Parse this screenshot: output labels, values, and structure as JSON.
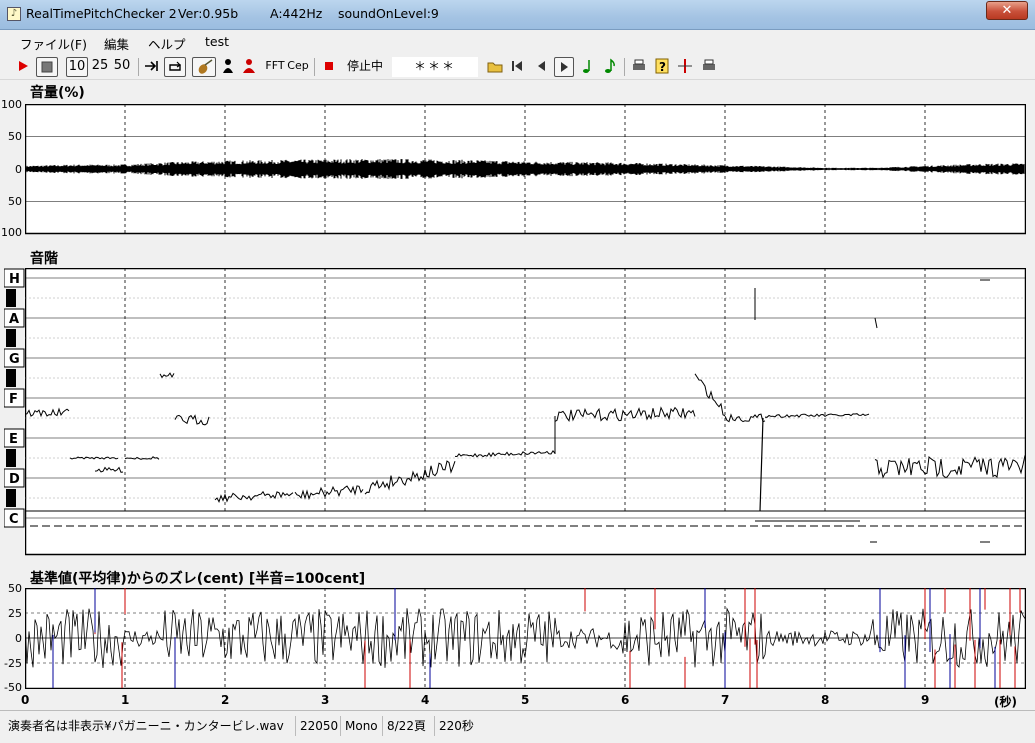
{
  "window": {
    "app_name": "RealTimePitchChecker 2",
    "version": "Ver:0.95b",
    "a_freq": "A:442Hz",
    "sound_on_level": "soundOnLevel:9",
    "close_label": "✕"
  },
  "menu": [
    "ファイル(F)",
    "編集",
    "ヘルプ",
    "test"
  ],
  "toolbar": {
    "speeds": [
      "10",
      "25",
      "50"
    ],
    "fft_label": "FFT",
    "cep_label": "Cep",
    "status_label": "停止中",
    "display_value": "＊＊＊"
  },
  "volume_panel": {
    "title": "音量(%)",
    "y_labels": [
      "100",
      "50",
      "0",
      "50",
      "100"
    ]
  },
  "scale_panel": {
    "title": "音階",
    "notes": [
      "H",
      "A",
      "G",
      "F",
      "E",
      "D",
      "C"
    ]
  },
  "cent_panel": {
    "title": "基準値(平均律)からのズレ(cent) [半音=100cent]",
    "y_labels": [
      "50",
      "25",
      "0",
      "-25",
      "-50"
    ]
  },
  "time_axis": {
    "labels": [
      "0",
      "1",
      "2",
      "3",
      "4",
      "5",
      "6",
      "7",
      "8",
      "9"
    ],
    "unit": "(秒)"
  },
  "status_bar": {
    "file": "演奏者名は非表示¥パガニーニ・カンタービレ.wav",
    "sample_rate": "22050",
    "channels": "Mono",
    "page": "8/22頁",
    "duration": "220秒"
  },
  "colors": {
    "title_bar": "#a4c3e3",
    "close_button": "#c9503a",
    "accent_red": "#cc0000",
    "accent_blue": "#000099",
    "accent_green": "#008800"
  },
  "chart_data": [
    {
      "type": "area",
      "title": "音量(%)",
      "xlabel": "(秒)",
      "xlim": [
        0,
        10
      ],
      "ylim": [
        -100,
        100
      ],
      "grid": true,
      "envelope": {
        "x": [
          0,
          0.5,
          1,
          1.5,
          2,
          2.5,
          3,
          3.5,
          4,
          4.5,
          5,
          5.5,
          6,
          6.5,
          7,
          7.5,
          8,
          8.5,
          9,
          9.5,
          10
        ],
        "amplitude": [
          5,
          7,
          7,
          11,
          13,
          14,
          15,
          16,
          15,
          14,
          12,
          11,
          10,
          8,
          6,
          4,
          2,
          2,
          5,
          8,
          9
        ]
      }
    },
    {
      "type": "line",
      "title": "音階",
      "xlabel": "(秒)",
      "xlim": [
        0,
        10
      ],
      "y_categories": [
        "C",
        "D",
        "E",
        "F",
        "G",
        "A",
        "H"
      ],
      "segments": [
        {
          "x": [
            0,
            0.45
          ],
          "y": [
            "E",
            "E"
          ]
        },
        {
          "x": [
            0.5,
            1.35
          ],
          "y": [
            "D",
            "D"
          ]
        },
        {
          "x": [
            1.35,
            1.85
          ],
          "y": [
            "F",
            "E"
          ]
        },
        {
          "x": [
            1.9,
            4.3
          ],
          "y": [
            "C",
            "C#"
          ]
        },
        {
          "x": [
            4.3,
            5.3
          ],
          "y": [
            "D",
            "D"
          ]
        },
        {
          "x": [
            5.3,
            6.7
          ],
          "y": [
            "E",
            "E"
          ]
        },
        {
          "x": [
            6.7,
            8.45
          ],
          "y": [
            "F",
            "E"
          ]
        },
        {
          "x": [
            8.5,
            10
          ],
          "y": [
            "D",
            "D"
          ]
        }
      ]
    },
    {
      "type": "line",
      "title": "基準値(平均律)からのズレ(cent) [半音=100cent]",
      "xlabel": "(秒)",
      "xlim": [
        0,
        10
      ],
      "ylim": [
        -50,
        50
      ],
      "grid": true
    }
  ]
}
